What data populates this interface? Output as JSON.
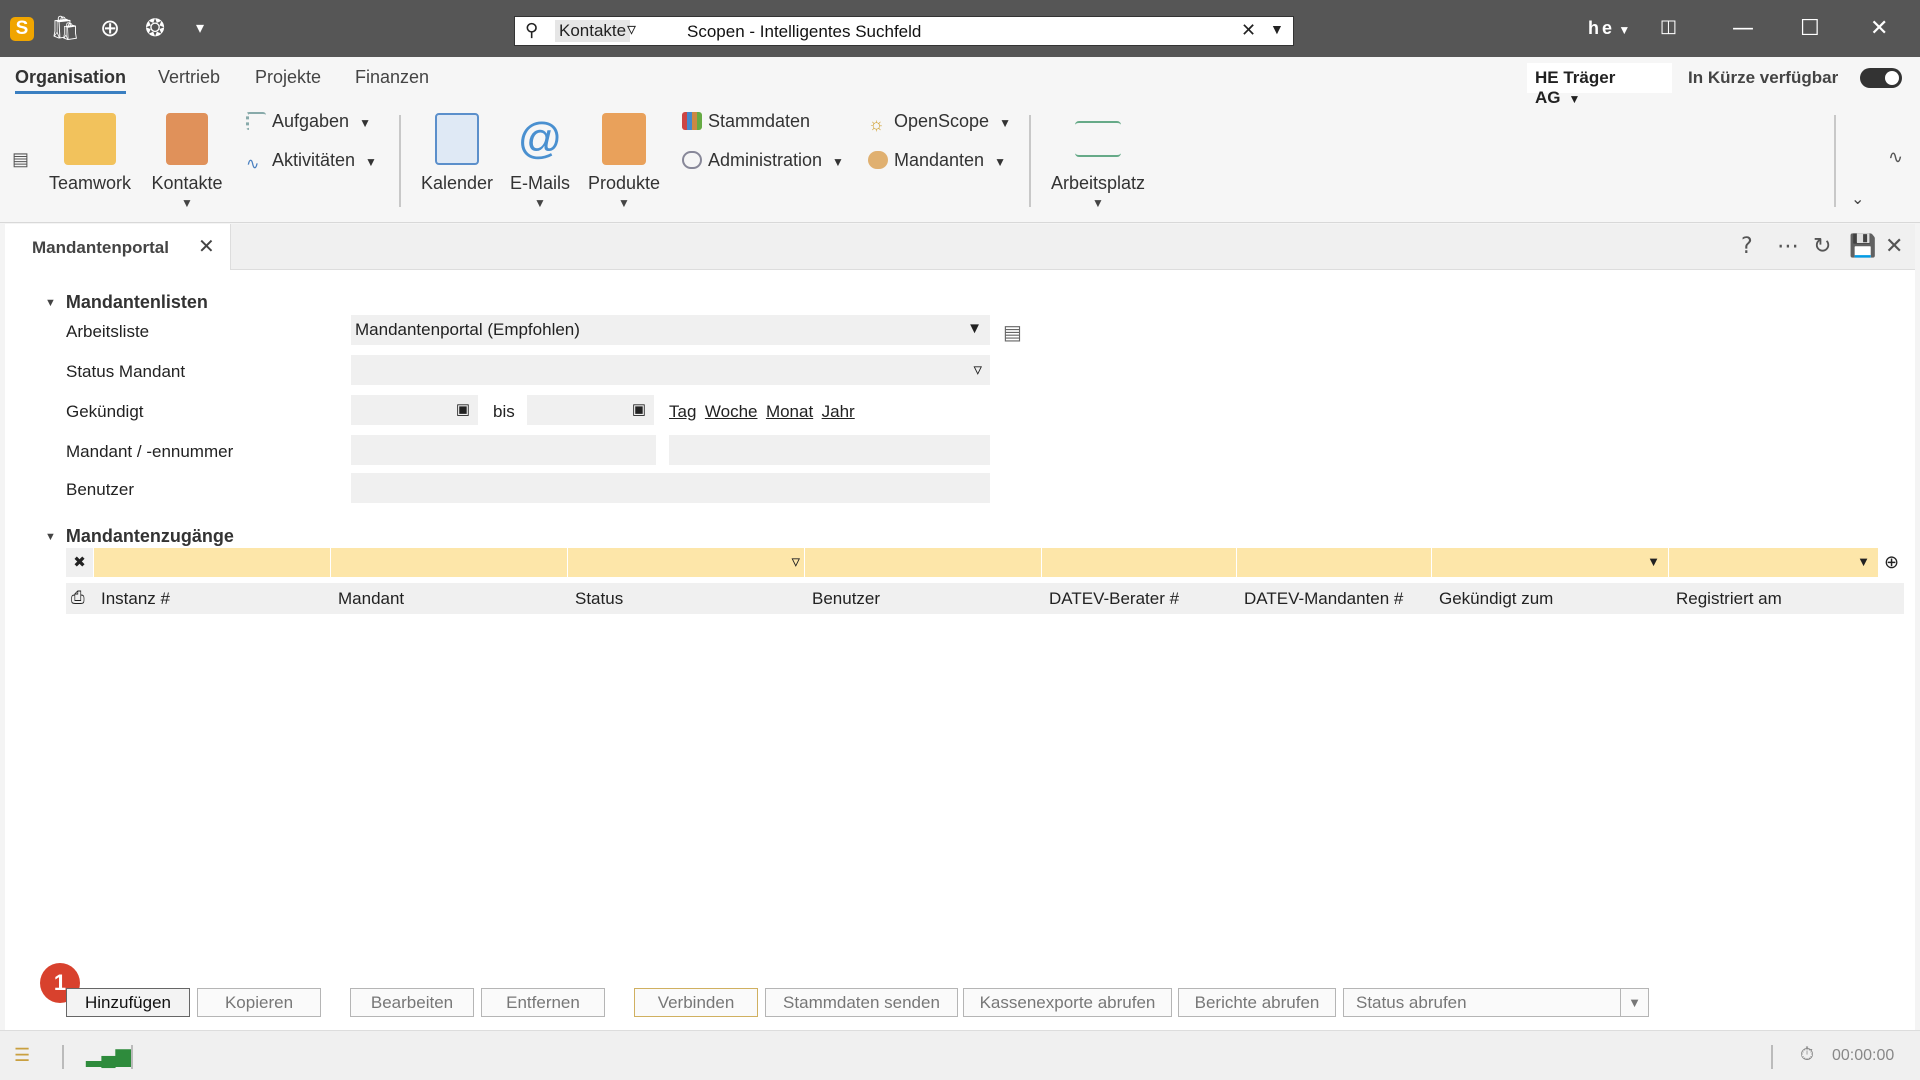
{
  "titlebar": {
    "search_scope": "Kontakte",
    "search_placeholder": "Scopen - Intelligentes Suchfeld",
    "user": "he"
  },
  "navtabs": [
    "Organisation",
    "Vertrieb",
    "Projekte",
    "Finanzen"
  ],
  "active_tab": "Organisation",
  "company": "HE Träger AG",
  "availability_label": "In Kürze verfügbar",
  "ribbon": {
    "teamwork": "Teamwork",
    "kontakte": "Kontakte",
    "aufgaben": "Aufgaben",
    "aktivitaeten": "Aktivitäten",
    "kalender": "Kalender",
    "emails": "E-Mails",
    "produkte": "Produkte",
    "stammdaten": "Stammdaten",
    "administration": "Administration",
    "openscope": "OpenScope",
    "mandanten": "Mandanten",
    "arbeitsplatz": "Arbeitsplatz"
  },
  "doc_tab": "Mandantenportal",
  "section1": {
    "title": "Mandantenlisten",
    "arbeitsliste_label": "Arbeitsliste",
    "arbeitsliste_value": "Mandantenportal (Empfohlen)",
    "status_label": "Status Mandant",
    "gekuendigt_label": "Gekündigt",
    "bis": "bis",
    "period_links": [
      "Tag",
      "Woche",
      "Monat",
      "Jahr"
    ],
    "mandant_label": "Mandant / -ennummer",
    "benutzer_label": "Benutzer"
  },
  "section2": {
    "title": "Mandantenzugänge",
    "columns": [
      "Instanz #",
      "Mandant",
      "Status",
      "Benutzer",
      "DATEV-Berater #",
      "DATEV-Mandanten #",
      "Gekündigt zum",
      "Registriert am"
    ]
  },
  "buttons": {
    "hinzufuegen": "Hinzufügen",
    "kopieren": "Kopieren",
    "bearbeiten": "Bearbeiten",
    "entfernen": "Entfernen",
    "verbinden": "Verbinden",
    "stammdaten_senden": "Stammdaten senden",
    "kassenexporte": "Kassenexporte abrufen",
    "berichte": "Berichte abrufen",
    "status_abrufen": "Status abrufen"
  },
  "badge": "1",
  "timer": "00:00:00",
  "colors": {
    "accent": "#3a7fc1",
    "filter_row": "#fde6a9",
    "badge": "#d8412d",
    "titlebar": "#565656"
  }
}
